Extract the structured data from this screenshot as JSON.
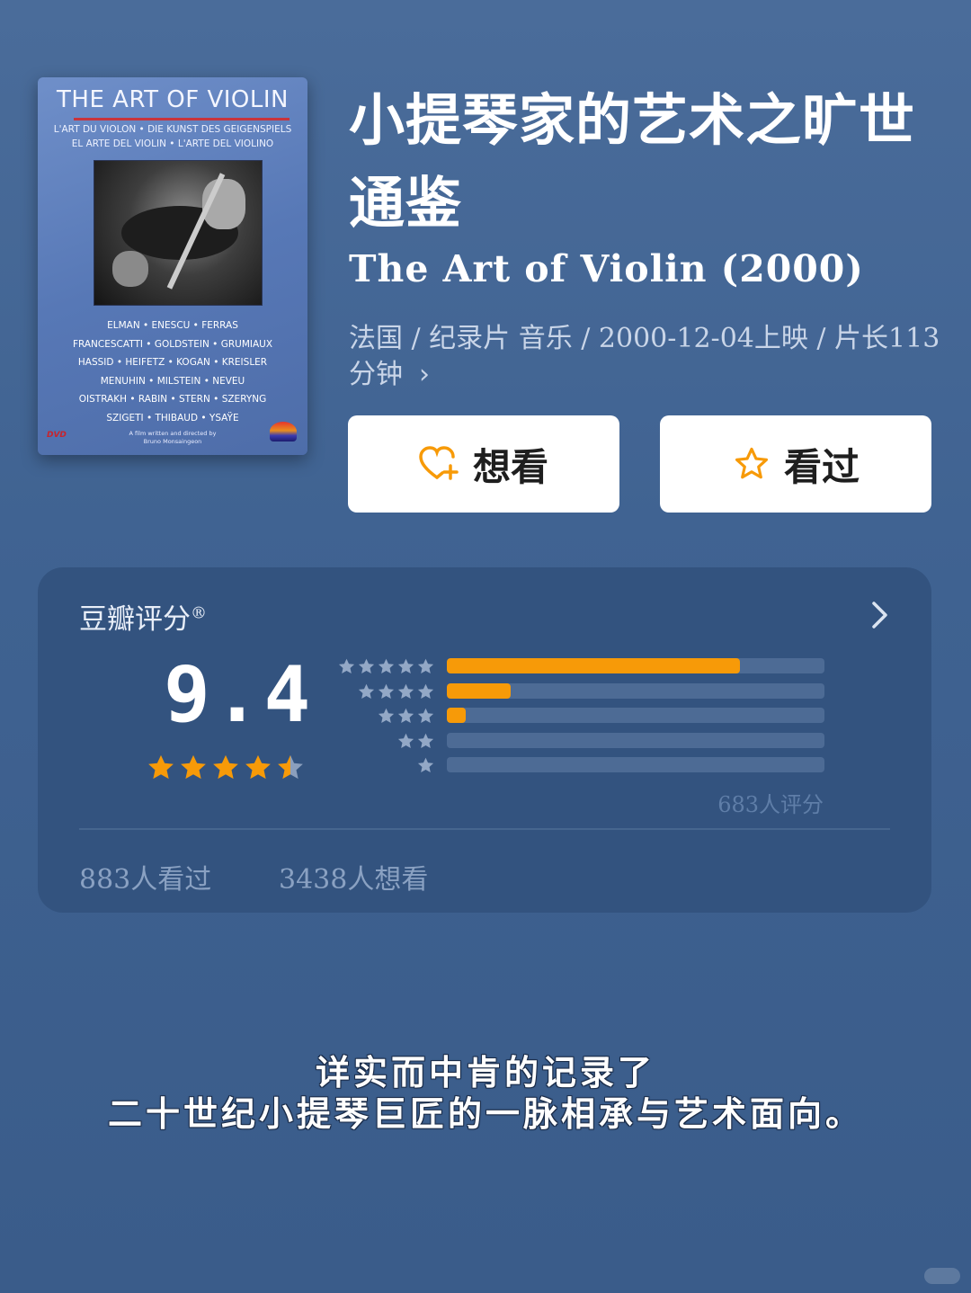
{
  "poster": {
    "title": "THE ART OF VIOLIN",
    "subtitle_line1": "L'ART DU VIOLON • DIE KUNST DES GEIGENSPIELS",
    "subtitle_line2": "EL ARTE DEL VIOLIN • L'ARTE DEL VIOLINO",
    "names": [
      "ELMAN  •  ENESCU  •  FERRAS",
      "FRANCESCATTI  •  GOLDSTEIN  •  GRUMIAUX",
      "HASSID  •  HEIFETZ  •  KOGAN  •  KREISLER",
      "MENUHIN  •  MILSTEIN  •  NEVEU",
      "OISTRAKH  •  RABIN  •  STERN  •  SZERYNG",
      "SZIGETI  •  THIBAUD  •  YSAŸE"
    ],
    "credit_line1": "A film written and directed by",
    "credit_line2": "Bruno Monsaingeon",
    "dvd_label": "DVD"
  },
  "movie": {
    "title_cn": "小提琴家的艺术之旷世通鉴",
    "title_en": "The Art of Violin (2000)",
    "meta": "法国 / 纪录片 音乐 / 2000-12-04上映 / 片长113分钟"
  },
  "buttons": {
    "want": "想看",
    "seen": "看过"
  },
  "rating": {
    "label": "豆瓣评分",
    "registered": "®",
    "score": "9.4",
    "score_stars": 4.5,
    "distribution": [
      {
        "stars": 5,
        "fraction": 0.775
      },
      {
        "stars": 4,
        "fraction": 0.17
      },
      {
        "stars": 3,
        "fraction": 0.05
      },
      {
        "stars": 2,
        "fraction": 0.0
      },
      {
        "stars": 1,
        "fraction": 0.0
      }
    ],
    "ratings_count": "683人评分",
    "seen_count": "883人看过",
    "want_count": "3438人想看"
  },
  "caption": {
    "line1": "详实而中肯的记录了",
    "line2": "二十世纪小提琴巨匠的一脉相承与艺术面向。"
  },
  "colors": {
    "background": "#3f6291",
    "card": "#33537f",
    "accent": "#f79a08",
    "bar_track": "#4d6b95"
  }
}
